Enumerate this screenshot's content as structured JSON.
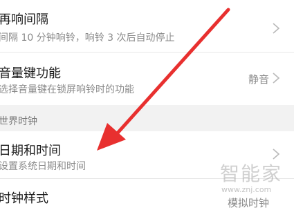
{
  "rows": [
    {
      "title": "再响间隔",
      "subtitle": "间隔 10 分钟响铃，响铃 3 次后自动停止",
      "value": ""
    },
    {
      "title": "音量键功能",
      "subtitle": "选择音量键在锁屏响铃时的功能",
      "value": "静音"
    },
    {
      "title": "日期和时间",
      "subtitle": "设置系统日期和时间",
      "value": ""
    },
    {
      "title": "时钟样式",
      "subtitle": "",
      "value": "模拟时钟"
    }
  ],
  "section_header": "世界时钟",
  "icons": {
    "chevron": "chevron-right-icon",
    "annotation": "red-arrow-annotation"
  },
  "watermark": {
    "text": "智能家",
    "url": "www.znj.com"
  },
  "colors": {
    "arrow": "#e8302f",
    "section_background": "#f2f2f2",
    "subtitle_text": "#8a8a8a"
  }
}
